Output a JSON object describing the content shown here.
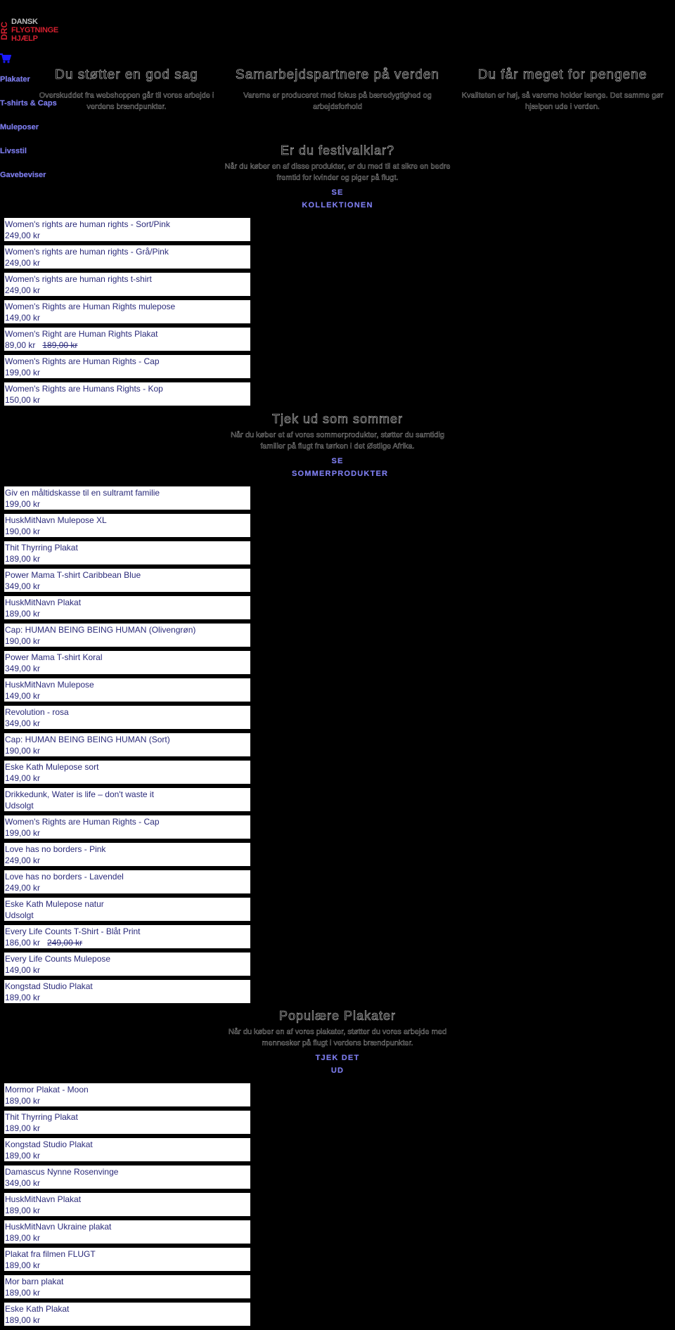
{
  "header": {
    "logo": {
      "abbr": "DRC",
      "line1": "DANSK",
      "line2": "FLYGTNINGE",
      "line3": "HJÆLP"
    },
    "cart_icon": "shopping-cart-icon",
    "brand_colors": {
      "red": "#d3202f",
      "link": "#7a7ae8",
      "product_text": "#2a2a7a"
    }
  },
  "nav": {
    "items": [
      {
        "label": "Plakater"
      },
      {
        "label": "T-shirts & Caps"
      },
      {
        "label": "Muleposer"
      },
      {
        "label": "Livsstil"
      },
      {
        "label": "Gavebeviser"
      }
    ]
  },
  "features": [
    {
      "title": "Du støtter en god sag",
      "text": "Overskuddet fra webshoppen går til vores arbejde i verdens brændpunkter."
    },
    {
      "title": "Samarbejdspartnere på verden",
      "text": "Varerne er produceret med fokus på bæredygtighed og arbejdsforhold"
    },
    {
      "title": "Du får meget for pengene",
      "text": "Kvaliteten er høj, så varerne holder længe. Det samme gør hjælpen ude i verden."
    }
  ],
  "sections": [
    {
      "title": "Er du festivalklar?",
      "text": "Når du køber en af disse produkter, er du med til at sikre en bedre fremtid for kvinder og piger på flugt.",
      "link_line1": "SE",
      "link_line2": "KOLLEKTIONEN",
      "products": [
        {
          "name": "Women's rights are human rights - Sort/Pink",
          "price": "249,00 kr",
          "old_price": ""
        },
        {
          "name": "Women's rights are human rights - Grå/Pink",
          "price": "249,00 kr",
          "old_price": ""
        },
        {
          "name": "Women's rights are human rights t-shirt",
          "price": "249,00 kr",
          "old_price": ""
        },
        {
          "name": "Women's Rights are Human Rights mulepose",
          "price": "149,00 kr",
          "old_price": ""
        },
        {
          "name": "Women's Right are Human Rights Plakat",
          "price": "89,00 kr",
          "old_price": "189,00 kr"
        },
        {
          "name": "Women's Rights are Human Rights - Cap",
          "price": "199,00 kr",
          "old_price": ""
        },
        {
          "name": "Women's Rights are Humans Rights - Kop",
          "price": "150,00 kr",
          "old_price": ""
        }
      ]
    },
    {
      "title": "Tjek ud som sommer",
      "text": "Når du køber et af vores sommerprodukter, støtter du samtidig familier på flugt fra tørken i det Østlige Afrika.",
      "link_line1": "SE",
      "link_line2": "SOMMERPRODUKTER",
      "products": [
        {
          "name": "Giv en måltidskasse til en sultramt familie",
          "price": "199,00 kr",
          "old_price": ""
        },
        {
          "name": "HuskMitNavn Mulepose XL",
          "price": "190,00 kr",
          "old_price": ""
        },
        {
          "name": "Thit Thyrring Plakat",
          "price": "189,00 kr",
          "old_price": ""
        },
        {
          "name": "Power Mama T-shirt Caribbean Blue",
          "price": "349,00 kr",
          "old_price": ""
        },
        {
          "name": "HuskMitNavn Plakat",
          "price": "189,00 kr",
          "old_price": ""
        },
        {
          "name": "Cap: HUMAN BEING BEING HUMAN (Olivengrøn)",
          "price": "190,00 kr",
          "old_price": ""
        },
        {
          "name": "Power Mama T-shirt Koral",
          "price": "349,00 kr",
          "old_price": ""
        },
        {
          "name": "HuskMitNavn Mulepose",
          "price": "149,00 kr",
          "old_price": ""
        },
        {
          "name": "Revolution - rosa",
          "price": "349,00 kr",
          "old_price": ""
        },
        {
          "name": "Cap: HUMAN BEING BEING HUMAN (Sort)",
          "price": "190,00 kr",
          "old_price": ""
        },
        {
          "name": "Eske Kath Mulepose sort",
          "price": "149,00 kr",
          "old_price": ""
        },
        {
          "name": "Drikkedunk, Water is life – don't waste it",
          "price": "Udsolgt",
          "old_price": ""
        },
        {
          "name": "Women's Rights are Human Rights - Cap",
          "price": "199,00 kr",
          "old_price": ""
        },
        {
          "name": "Love has no borders - Pink",
          "price": "249,00 kr",
          "old_price": ""
        },
        {
          "name": "Love has no borders - Lavendel",
          "price": "249,00 kr",
          "old_price": ""
        },
        {
          "name": "Eske Kath Mulepose natur",
          "price": "Udsolgt",
          "old_price": ""
        },
        {
          "name": "Every Life Counts T-Shirt - Blåt Print",
          "price": "186,00 kr",
          "old_price": "249,00 kr"
        },
        {
          "name": "Every Life Counts Mulepose",
          "price": "149,00 kr",
          "old_price": ""
        },
        {
          "name": "Kongstad Studio Plakat",
          "price": "189,00 kr",
          "old_price": ""
        }
      ]
    },
    {
      "title": "Populære Plakater",
      "text": "Når du køber en af vores plakater, støtter du vores arbejde med mennesker på flugt i verdens brændpunkter.",
      "link_line1": "TJEK DET",
      "link_line2": "UD",
      "products": [
        {
          "name": "Mormor Plakat - Moon",
          "price": "189,00 kr",
          "old_price": ""
        },
        {
          "name": "Thit Thyrring Plakat",
          "price": "189,00 kr",
          "old_price": ""
        },
        {
          "name": "Kongstad Studio Plakat",
          "price": "189,00 kr",
          "old_price": ""
        },
        {
          "name": "Damascus Nynne Rosenvinge",
          "price": "349,00 kr",
          "old_price": ""
        },
        {
          "name": "HuskMitNavn Plakat",
          "price": "189,00 kr",
          "old_price": ""
        },
        {
          "name": "HuskMitNavn Ukraine plakat",
          "price": "189,00 kr",
          "old_price": ""
        },
        {
          "name": "Plakat fra filmen FLUGT",
          "price": "189,00 kr",
          "old_price": ""
        },
        {
          "name": "Mor barn plakat",
          "price": "189,00 kr",
          "old_price": ""
        },
        {
          "name": "Eske Kath Plakat",
          "price": "189,00 kr",
          "old_price": ""
        }
      ]
    }
  ]
}
